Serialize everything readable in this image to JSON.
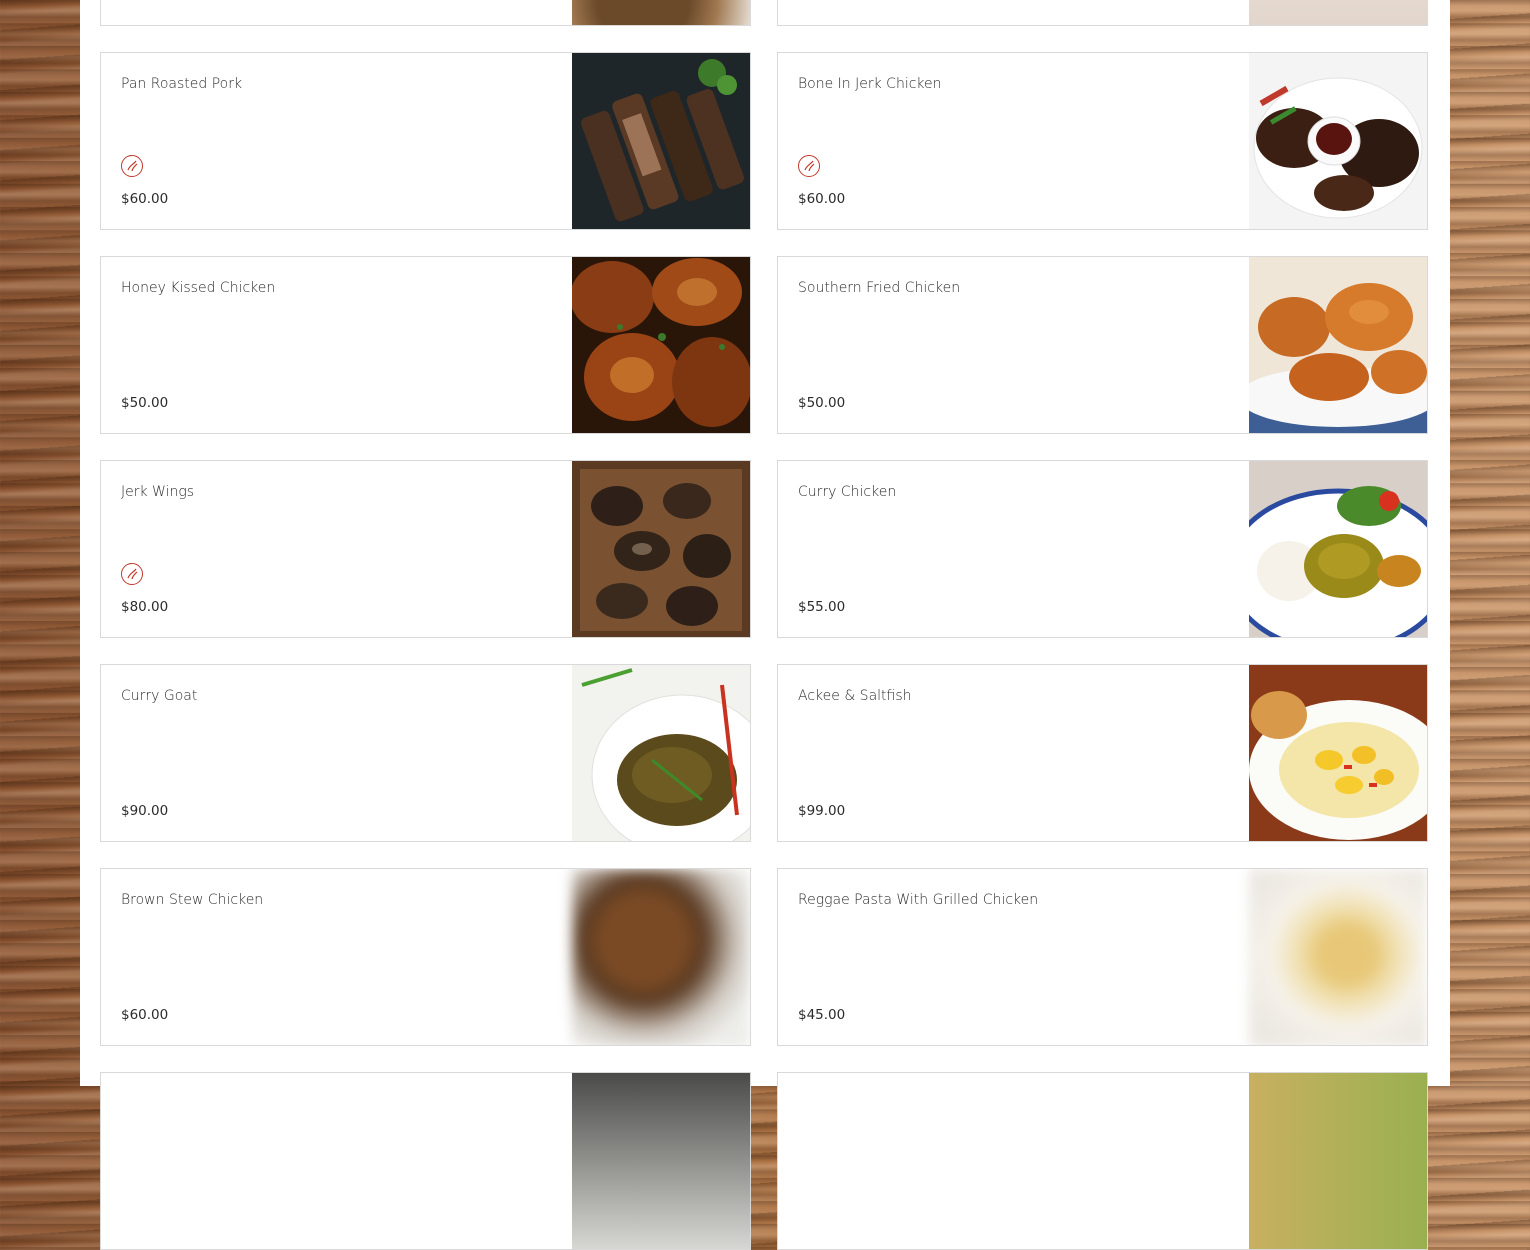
{
  "menu": {
    "accent_color": "#c0392b",
    "items": [
      {
        "name": "Pan Roasted Pork",
        "price": "$60.00",
        "spicy": true,
        "photo": "ribs-photo"
      },
      {
        "name": "Bone In Jerk Chicken",
        "price": "$60.00",
        "spicy": true,
        "photo": "jerk-chicken-photo"
      },
      {
        "name": "Honey Kissed Chicken",
        "price": "$50.00",
        "spicy": false,
        "photo": "honey-chicken-photo"
      },
      {
        "name": "Southern Fried Chicken",
        "price": "$50.00",
        "spicy": false,
        "photo": "fried-chicken-photo"
      },
      {
        "name": "Jerk Wings",
        "price": "$80.00",
        "spicy": true,
        "photo": "wings-photo"
      },
      {
        "name": "Curry Chicken",
        "price": "$55.00",
        "spicy": false,
        "photo": "curry-chicken-photo"
      },
      {
        "name": "Curry Goat",
        "price": "$90.00",
        "spicy": false,
        "photo": "curry-goat-photo"
      },
      {
        "name": "Ackee & Saltfish",
        "price": "$99.00",
        "spicy": false,
        "photo": "ackee-saltfish-photo"
      },
      {
        "name": "Brown Stew Chicken",
        "price": "$60.00",
        "spicy": false,
        "photo": "brown-stew-photo"
      },
      {
        "name": "Reggae Pasta With Grilled Chicken",
        "price": "$45.00",
        "spicy": false,
        "photo": "reggae-pasta-photo"
      }
    ]
  }
}
